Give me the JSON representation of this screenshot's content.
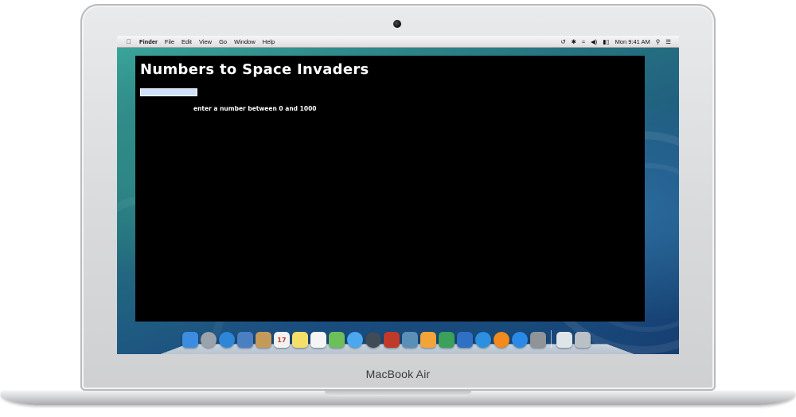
{
  "menubar": {
    "apple_icon": "apple-logo-icon",
    "items": [
      "Finder",
      "File",
      "Edit",
      "View",
      "Go",
      "Window",
      "Help"
    ],
    "clock": "Mon 9:41 AM",
    "status_icons": [
      "time-machine-icon",
      "bluetooth-icon",
      "wifi-icon",
      "volume-icon",
      "battery-icon",
      "spotlight-icon",
      "notification-center-icon"
    ]
  },
  "app": {
    "title": "Numbers to Space Invaders",
    "input": {
      "value": "",
      "placeholder": ""
    },
    "hint": "enter a number between 0 and 1000",
    "colors": {
      "background": "#000000",
      "text": "#ffffff"
    }
  },
  "dock": {
    "apps": [
      {
        "name": "finder-icon",
        "color": "#3c8de0"
      },
      {
        "name": "launchpad-icon",
        "color": "#9aa3ab"
      },
      {
        "name": "safari-icon",
        "color": "#2f86d8"
      },
      {
        "name": "mail-icon",
        "color": "#4a7fc4"
      },
      {
        "name": "contacts-icon",
        "color": "#c49a5a"
      },
      {
        "name": "calendar-icon",
        "color": "#f2f2f2",
        "label": "17"
      },
      {
        "name": "notes-icon",
        "color": "#f4df6a"
      },
      {
        "name": "reminders-icon",
        "color": "#f5f5f5"
      },
      {
        "name": "maps-icon",
        "color": "#6cbf5a"
      },
      {
        "name": "messages-icon",
        "color": "#4aa7f0"
      },
      {
        "name": "facetime-icon",
        "color": "#3f4b55"
      },
      {
        "name": "photo-booth-icon",
        "color": "#c03a2b"
      },
      {
        "name": "iphoto-icon",
        "color": "#5a8fb8"
      },
      {
        "name": "pages-icon",
        "color": "#f1a43a"
      },
      {
        "name": "numbers-icon",
        "color": "#3aa05a"
      },
      {
        "name": "keynote-icon",
        "color": "#2f6fc4"
      },
      {
        "name": "itunes-icon",
        "color": "#2d8fe0"
      },
      {
        "name": "ibooks-icon",
        "color": "#f28a1e"
      },
      {
        "name": "app-store-icon",
        "color": "#2b8ae6"
      },
      {
        "name": "system-preferences-icon",
        "color": "#8f9499"
      }
    ],
    "right_items": [
      {
        "name": "downloads-stack-icon",
        "color": "#dfe4e8"
      },
      {
        "name": "trash-icon",
        "color": "#b9c0c6"
      }
    ]
  },
  "device": {
    "brand": "MacBook Air"
  }
}
